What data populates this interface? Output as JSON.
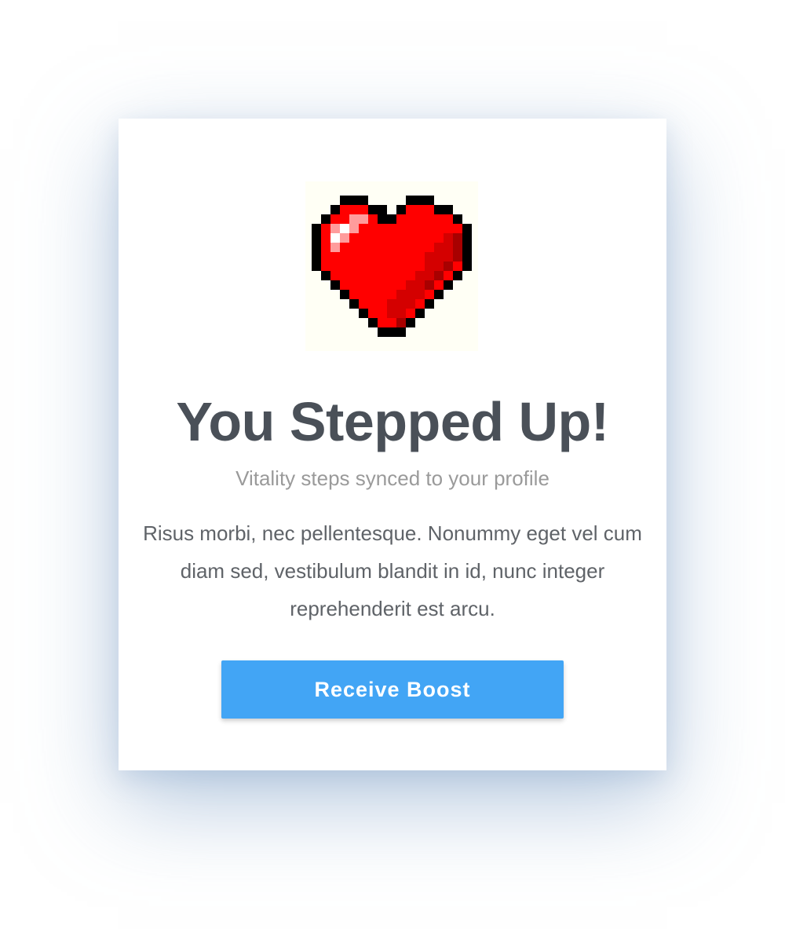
{
  "card": {
    "icon": "pixel-heart-icon",
    "title": "You Stepped Up!",
    "subtitle": "Vitality steps synced to your profile",
    "body": "Risus morbi, nec pellentesque. Nonummy eget vel cum diam sed, vestibulum blandit in id, nunc integer reprehenderit est arcu.",
    "button_label": "Receive Boost"
  },
  "colors": {
    "button": "#42a5f5",
    "heart_red": "#ff0000",
    "title_text": "#4a5058",
    "subtitle_text": "#9a9a9a",
    "body_text": "#5f6368"
  }
}
